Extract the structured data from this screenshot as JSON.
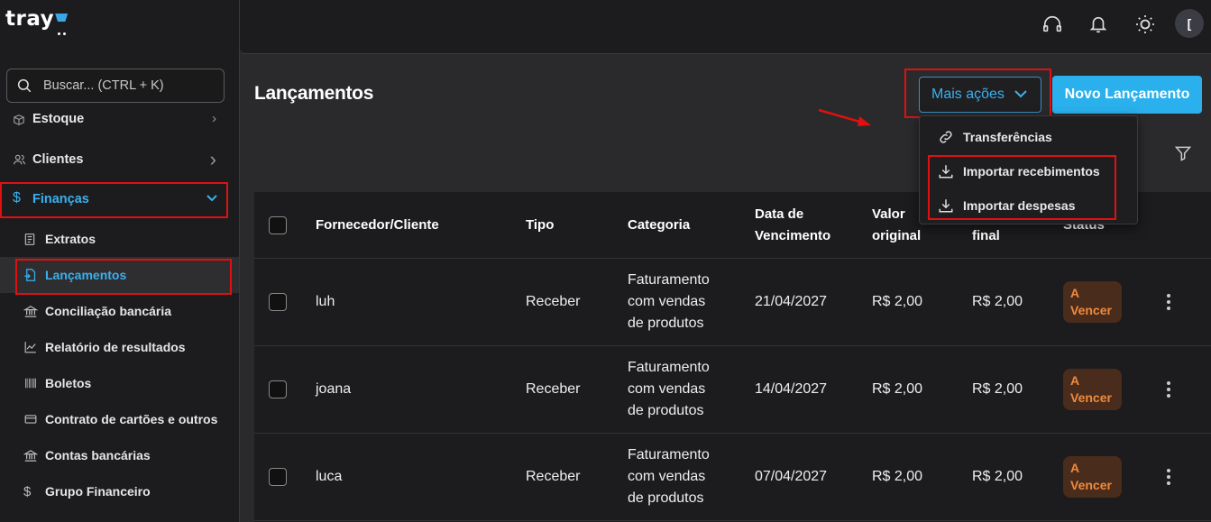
{
  "brand": {
    "logo_text": "tray"
  },
  "search": {
    "placeholder": "Buscar... (CTRL + K)"
  },
  "sidebar": {
    "items": [
      {
        "label": "Estoque"
      },
      {
        "label": "Clientes"
      },
      {
        "label": "Finanças"
      }
    ],
    "sub_items": [
      {
        "label": "Extratos"
      },
      {
        "label": "Lançamentos"
      },
      {
        "label": "Conciliação bancária"
      },
      {
        "label": "Relatório de resultados"
      },
      {
        "label": "Boletos"
      },
      {
        "label": "Contrato de cartões e outros"
      },
      {
        "label": "Contas bancárias"
      },
      {
        "label": "Grupo Financeiro"
      }
    ]
  },
  "header": {
    "avatar_initial": "["
  },
  "page": {
    "title": "Lançamentos",
    "more_actions_label": "Mais ações",
    "new_button_label": "Novo Lançamento"
  },
  "dropdown": {
    "items": [
      {
        "label": "Transferências",
        "icon": "link-icon"
      },
      {
        "label": "Importar recebimentos",
        "icon": "download-icon"
      },
      {
        "label": "Importar despesas",
        "icon": "download-icon"
      }
    ]
  },
  "table": {
    "headers": {
      "fornecedor": "Fornecedor/Cliente",
      "tipo": "Tipo",
      "categoria": "Categoria",
      "vencimento_1": "Data de",
      "vencimento_2": "Vencimento",
      "valor_original_1": "Valor",
      "valor_original_2": "original",
      "valor_final": "final",
      "status": "Status"
    },
    "rows": [
      {
        "name": "luh",
        "tipo": "Receber",
        "cat_1": "Faturamento",
        "cat_2": "com vendas",
        "cat_3": "de produtos",
        "date": "21/04/2027",
        "original": "R$ 2,00",
        "final": "R$ 2,00",
        "status_1": "A",
        "status_2": "Vencer"
      },
      {
        "name": "joana",
        "tipo": "Receber",
        "cat_1": "Faturamento",
        "cat_2": "com vendas",
        "cat_3": "de produtos",
        "date": "14/04/2027",
        "original": "R$ 2,00",
        "final": "R$ 2,00",
        "status_1": "A",
        "status_2": "Vencer"
      },
      {
        "name": "luca",
        "tipo": "Receber",
        "cat_1": "Faturamento",
        "cat_2": "com vendas",
        "cat_3": "de produtos",
        "date": "07/04/2027",
        "original": "R$ 2,00",
        "final": "R$ 2,00",
        "status_1": "A",
        "status_2": "Vencer"
      }
    ]
  },
  "colors": {
    "accent": "#2ab0ec",
    "status_bg": "#4a2c1c",
    "status_text": "#f08a3c",
    "annotation": "#e01010"
  }
}
